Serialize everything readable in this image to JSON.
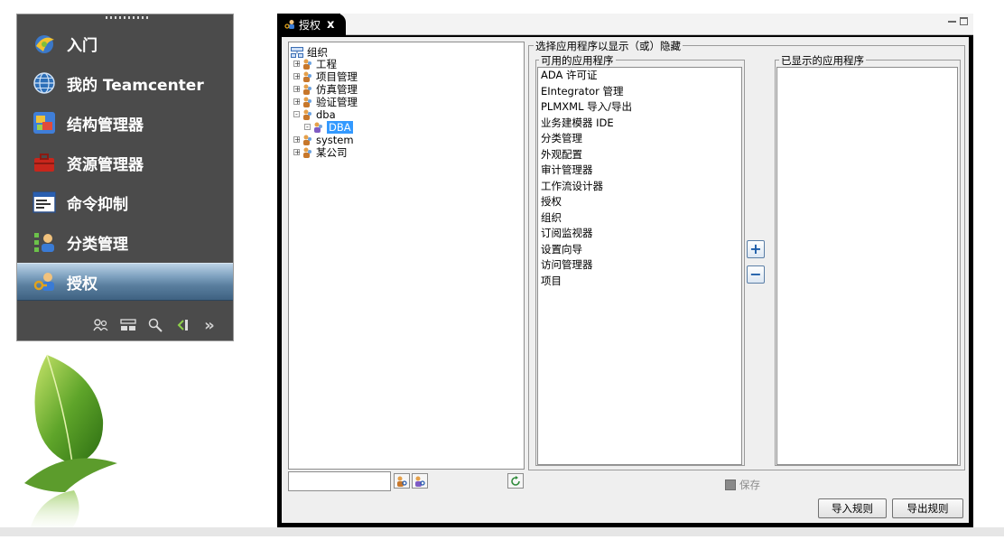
{
  "navigator": {
    "items": [
      {
        "label": "入门",
        "icon": "getting-started-icon"
      },
      {
        "label": "我的 Teamcenter",
        "icon": "globe-icon"
      },
      {
        "label": "结构管理器",
        "icon": "structure-manager-icon"
      },
      {
        "label": "资源管理器",
        "icon": "toolbox-icon"
      },
      {
        "label": "命令抑制",
        "icon": "command-window-icon"
      },
      {
        "label": "分类管理",
        "icon": "classification-icon"
      },
      {
        "label": "授权",
        "icon": "access-key-icon"
      }
    ],
    "active_index": 6,
    "toolbar_icons": [
      "users-icon",
      "layout-icon",
      "search-icon",
      "arrow-icon",
      "more-icon"
    ],
    "more_glyph": "»"
  },
  "window": {
    "tab_label": "授权",
    "tab_close": "x",
    "tree": {
      "nodes": [
        {
          "label": "组织",
          "level": 0,
          "expander": ""
        },
        {
          "label": "工程",
          "level": 1,
          "expander": "+"
        },
        {
          "label": "项目管理",
          "level": 1,
          "expander": "+"
        },
        {
          "label": "仿真管理",
          "level": 1,
          "expander": "+"
        },
        {
          "label": "验证管理",
          "level": 1,
          "expander": "+"
        },
        {
          "label": "dba",
          "level": 1,
          "expander": "-"
        },
        {
          "label": "DBA",
          "level": 2,
          "expander": "-",
          "selected": true
        },
        {
          "label": "system",
          "level": 1,
          "expander": "+"
        },
        {
          "label": "某公司",
          "level": 1,
          "expander": "+"
        }
      ],
      "search_value": ""
    },
    "group_title": "选择应用程序以显示（或）隐藏",
    "available": {
      "title": "可用的应用程序",
      "items": [
        "ADA 许可证",
        "EIntegrator 管理",
        "PLMXML 导入/导出",
        "业务建模器 IDE",
        "分类管理",
        "外观配置",
        "审计管理器",
        "工作流设计器",
        "授权",
        "组织",
        "订阅监视器",
        "设置向导",
        "访问管理器",
        "项目"
      ]
    },
    "shown": {
      "title": "已显示的应用程序",
      "items": []
    },
    "add_glyph": "+",
    "remove_glyph": "−",
    "save_label": "保存",
    "import_label": "导入规则",
    "export_label": "导出规则"
  },
  "colors": {
    "nav_bg": "#4b4b4b",
    "nav_active": "#5a7f9f",
    "selection": "#3399ff",
    "window_frame": "#000000"
  }
}
